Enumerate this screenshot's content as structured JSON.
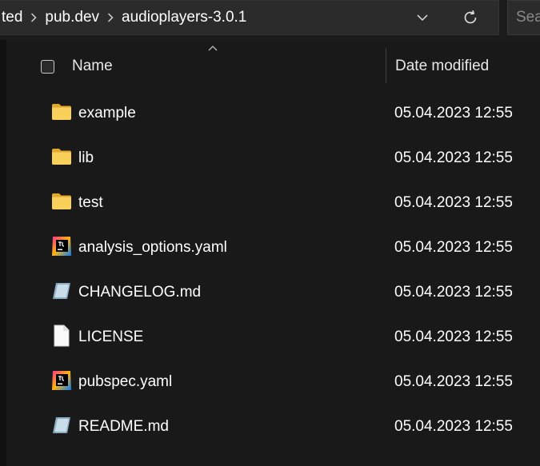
{
  "address_bar": {
    "breadcrumbs": [
      "ted",
      "pub.dev",
      "audioplayers-3.0.1"
    ]
  },
  "search": {
    "placeholder": "Sea"
  },
  "columns": {
    "name": "Name",
    "date_modified": "Date modified"
  },
  "files": [
    {
      "name": "example",
      "date": "05.04.2023 12:55",
      "icon": "folder-icon"
    },
    {
      "name": "lib",
      "date": "05.04.2023 12:55",
      "icon": "folder-icon"
    },
    {
      "name": "test",
      "date": "05.04.2023 12:55",
      "icon": "folder-icon"
    },
    {
      "name": "analysis_options.yaml",
      "date": "05.04.2023 12:55",
      "icon": "jetbrains-icon"
    },
    {
      "name": "CHANGELOG.md",
      "date": "05.04.2023 12:55",
      "icon": "markdown-icon"
    },
    {
      "name": "LICENSE",
      "date": "05.04.2023 12:55",
      "icon": "file-icon"
    },
    {
      "name": "pubspec.yaml",
      "date": "05.04.2023 12:55",
      "icon": "jetbrains-icon"
    },
    {
      "name": "README.md",
      "date": "05.04.2023 12:55",
      "icon": "markdown-icon"
    }
  ],
  "colors": {
    "background": "#191919",
    "address_bg": "#2b2b2b",
    "folder": "#f6c342"
  }
}
